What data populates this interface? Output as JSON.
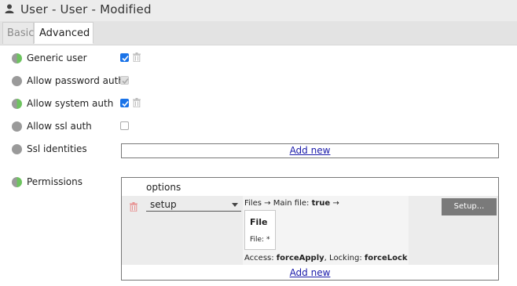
{
  "window": {
    "title": "User - User - Modified",
    "icon": "user-icon"
  },
  "tabs": [
    {
      "label": "Basic",
      "active": false
    },
    {
      "label": "Advanced",
      "active": true
    }
  ],
  "fields": {
    "generic_user": {
      "label": "Generic user",
      "status": "green",
      "checked": true,
      "disabled": false,
      "has_delete": true
    },
    "allow_password_auth": {
      "label": "Allow password auth",
      "status": "gray",
      "checked": true,
      "disabled": true,
      "has_delete": false
    },
    "allow_system_auth": {
      "label": "Allow system auth",
      "status": "green",
      "checked": true,
      "disabled": false,
      "has_delete": true
    },
    "allow_ssl_auth": {
      "label": "Allow ssl auth",
      "status": "gray",
      "checked": false,
      "disabled": false,
      "has_delete": false
    },
    "ssl_identities": {
      "label": "Ssl identities",
      "status": "gray",
      "add_label": "Add new"
    },
    "permissions": {
      "label": "Permissions",
      "status": "green",
      "options_label": "options",
      "entry": {
        "select_value": "setup",
        "path": {
          "part1": "Files",
          "arrow1": "→",
          "part2": "Main file:",
          "value": "true",
          "arrow2": "→"
        },
        "file_card": {
          "title": "File",
          "subtitle": "File: *"
        },
        "access": {
          "access_label": "Access:",
          "access_value": "forceApply",
          "locking_label": "Locking:",
          "locking_value": "forceLock"
        },
        "setup_button": "Setup..."
      },
      "add_label": "Add new"
    }
  },
  "colors": {
    "status_green": "#6dc35f",
    "status_gray": "#9a9a9a",
    "checkbox_blue": "#1a73e8",
    "trash_red": "#e05050",
    "link": "#1a1aaa"
  }
}
